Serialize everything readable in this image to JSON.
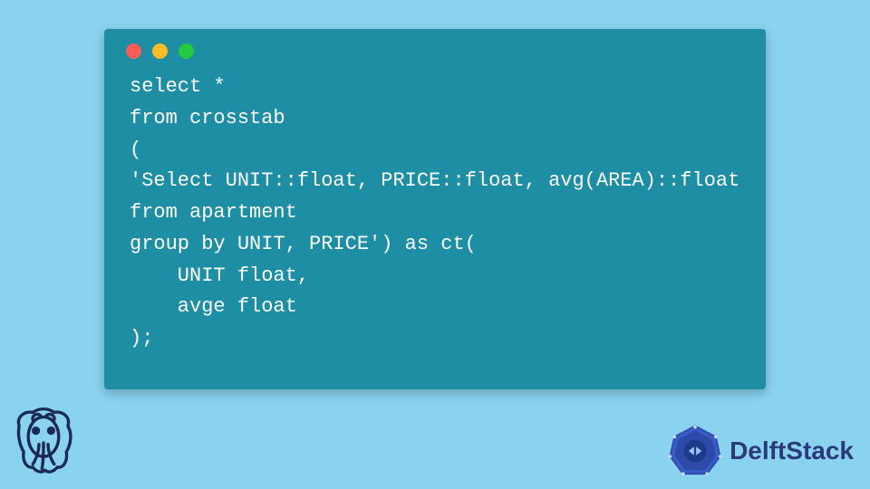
{
  "window": {
    "code_lines": [
      "select *",
      "from crosstab",
      "(",
      "'Select UNIT::float, PRICE::float, avg(AREA)::float",
      "from apartment",
      "group by UNIT, PRICE') as ct(",
      "    UNIT float,",
      "    avge float",
      ");"
    ]
  },
  "brand": {
    "name": "DelftStack"
  }
}
